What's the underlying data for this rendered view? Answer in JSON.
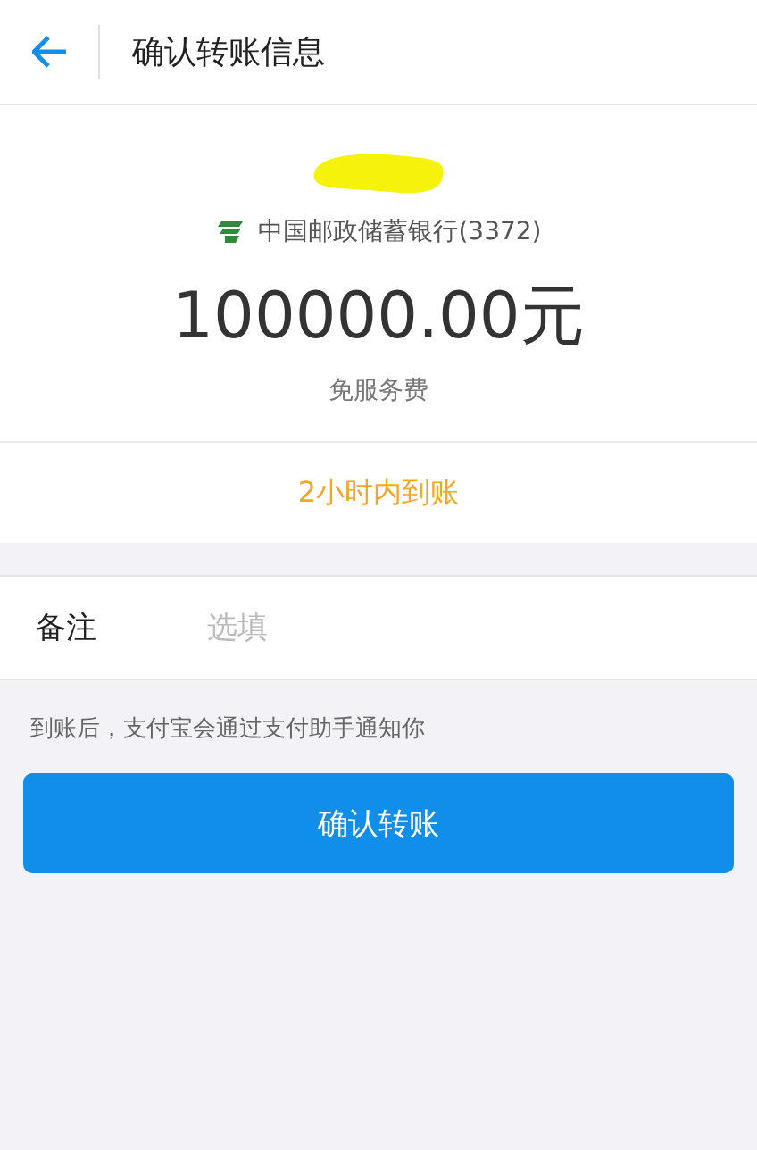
{
  "header": {
    "title": "确认转账信息"
  },
  "transfer": {
    "bank": "中国邮政储蓄银行(3372)",
    "amount": "100000.00元",
    "fee": "免服务费"
  },
  "arrival": {
    "text": "2小时内到账"
  },
  "note": {
    "label": "备注",
    "placeholder": "选填"
  },
  "hint": "到账后，支付宝会通过支付助手通知你",
  "buttons": [
    {
      "label": "确认转账"
    }
  ]
}
